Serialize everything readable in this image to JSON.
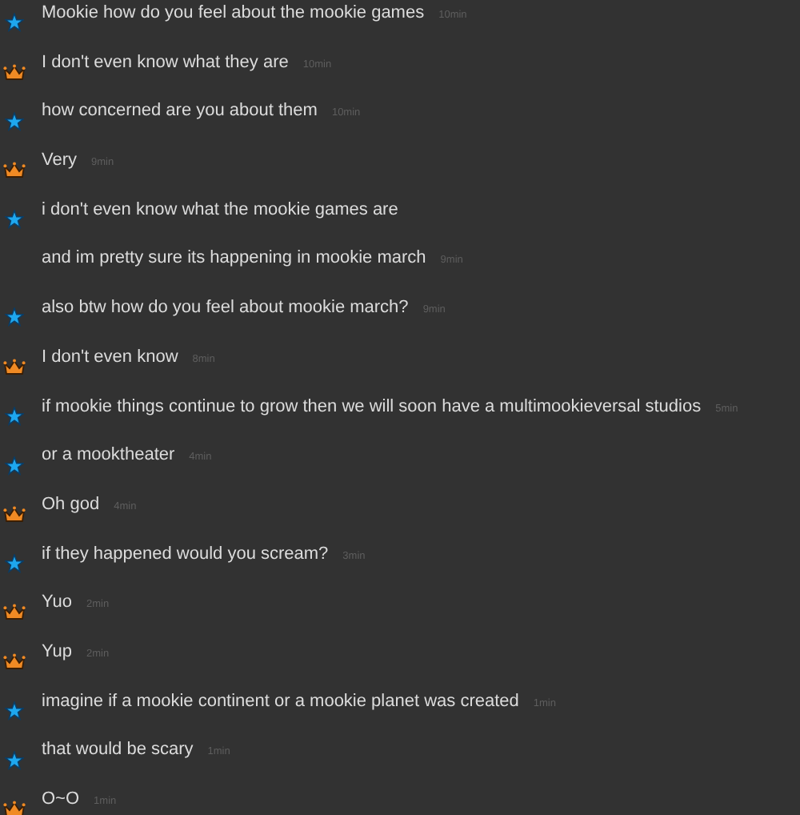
{
  "messages": [
    {
      "kind": "star",
      "text": "Mookie how do you feel about the mookie games",
      "time": "10min"
    },
    {
      "kind": "crown",
      "text": "I don't even know what they are",
      "time": "10min"
    },
    {
      "kind": "star",
      "text": "how concerned are you about them",
      "time": "10min"
    },
    {
      "kind": "crown",
      "text": "Very",
      "time": "9min"
    },
    {
      "kind": "star",
      "text": "i don't even know what the mookie games are"
    },
    {
      "kind": "none",
      "text": "and im pretty sure its happening in mookie march",
      "time": "9min"
    },
    {
      "kind": "star",
      "text": "also btw how do you feel about mookie march?",
      "time": "9min"
    },
    {
      "kind": "crown",
      "text": "I don't even know",
      "time": "8min"
    },
    {
      "kind": "star",
      "text": "if mookie things continue to grow then we will soon have a multimookieversal studios",
      "time": "5min"
    },
    {
      "kind": "star",
      "text": "or a mooktheater",
      "time": "4min"
    },
    {
      "kind": "crown",
      "text": "Oh god",
      "time": "4min"
    },
    {
      "kind": "star",
      "text": "if they happened would you scream?",
      "time": "3min"
    },
    {
      "kind": "crown",
      "text": "Yuo",
      "time": "2min"
    },
    {
      "kind": "crown",
      "text": "Yup",
      "time": "2min"
    },
    {
      "kind": "star",
      "text": "imagine if a mookie continent or a mookie planet was created",
      "time": "1min"
    },
    {
      "kind": "star",
      "text": "that would be scary",
      "time": "1min"
    },
    {
      "kind": "crown",
      "text": "O~O",
      "time": "1min"
    }
  ]
}
